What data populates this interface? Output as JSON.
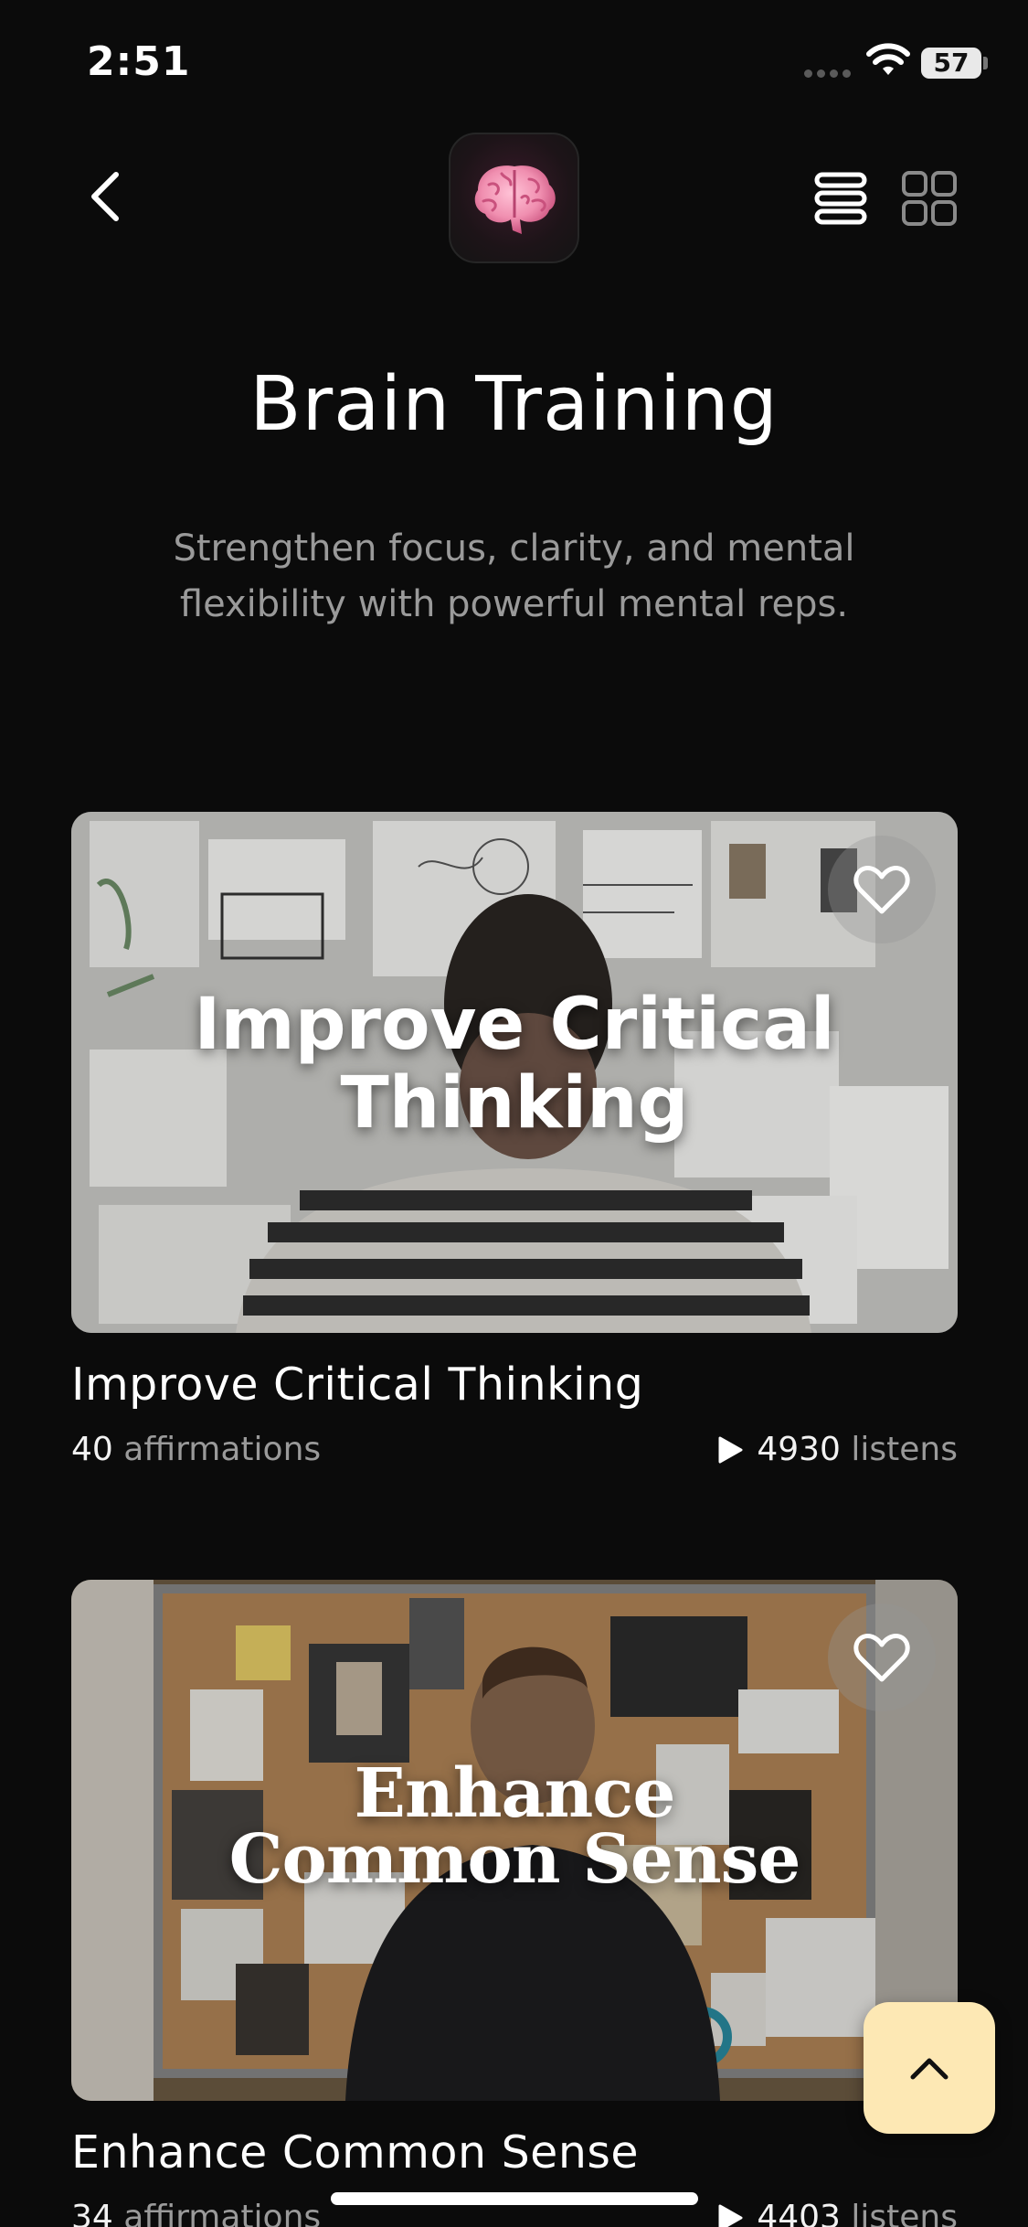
{
  "status_bar": {
    "time": "2:51",
    "battery": "57"
  },
  "header": {
    "back_icon": "chevron-left-icon",
    "app_icon": "brain-icon",
    "view_toggle": {
      "list_icon": "list-view-icon",
      "grid_icon": "grid-view-icon",
      "active": "list"
    }
  },
  "page": {
    "title": "Brain Training",
    "subtitle": "Strengthen focus, clarity, and mental flexibility with powerful mental reps."
  },
  "cards": [
    {
      "image_caption_line1": "Improve Critical",
      "image_caption_line2": "Thinking",
      "title": "Improve Critical Thinking",
      "affirmations_count": "40",
      "affirmations_label": "affirmations",
      "listens_count": "4930",
      "listens_label": "listens"
    },
    {
      "image_caption_line1": "Enhance",
      "image_caption_line2": "Common Sense",
      "title": "Enhance Common Sense",
      "affirmations_count": "34",
      "affirmations_label": "affirmations",
      "listens_count": "4403",
      "listens_label": "listens"
    }
  ],
  "scroll_top": {
    "icon": "chevron-up-icon"
  },
  "colors": {
    "background": "#0b0b0b",
    "scroll_button": "#fde8b4",
    "muted_text": "#9a9a9a"
  }
}
